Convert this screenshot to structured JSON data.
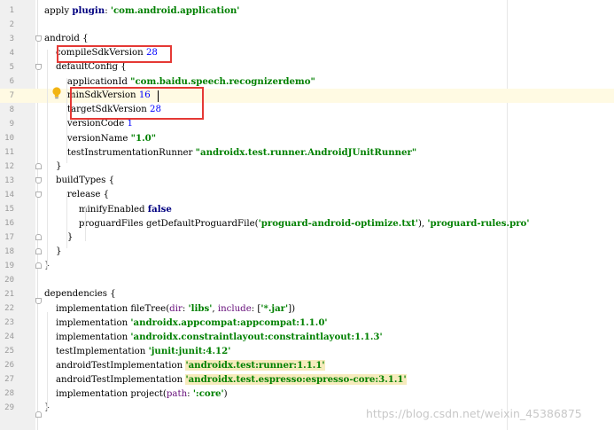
{
  "editor": {
    "lines": [
      {
        "n": "1",
        "segs": [
          [
            "t",
            "apply "
          ],
          [
            "kw",
            "plugin"
          ],
          [
            "t",
            ": "
          ],
          [
            "str",
            "'com.android.application'"
          ]
        ]
      },
      {
        "n": "2",
        "segs": []
      },
      {
        "n": "3",
        "segs": [
          [
            "t",
            "android {"
          ]
        ]
      },
      {
        "n": "4",
        "segs": [
          [
            "t",
            "    compileSdkVersion "
          ],
          [
            "num",
            "28"
          ]
        ]
      },
      {
        "n": "5",
        "segs": [
          [
            "t",
            "    defaultConfig {"
          ]
        ]
      },
      {
        "n": "6",
        "segs": [
          [
            "t",
            "        applicationId "
          ],
          [
            "str",
            "\"com.baidu.speech.recognizerdemo\""
          ]
        ]
      },
      {
        "n": "7",
        "segs": [
          [
            "t",
            "        minSdkVersion "
          ],
          [
            "num",
            "16"
          ]
        ]
      },
      {
        "n": "8",
        "segs": [
          [
            "t",
            "        targetSdkVersion "
          ],
          [
            "num",
            "28"
          ]
        ]
      },
      {
        "n": "9",
        "segs": [
          [
            "t",
            "        versionCode "
          ],
          [
            "num",
            "1"
          ]
        ]
      },
      {
        "n": "10",
        "segs": [
          [
            "t",
            "        versionName "
          ],
          [
            "str",
            "\"1.0\""
          ]
        ]
      },
      {
        "n": "11",
        "segs": [
          [
            "t",
            "        testInstrumentationRunner "
          ],
          [
            "str",
            "\"androidx.test.runner.AndroidJUnitRunner\""
          ]
        ]
      },
      {
        "n": "12",
        "segs": [
          [
            "t",
            "    }"
          ]
        ]
      },
      {
        "n": "13",
        "segs": [
          [
            "t",
            "    buildTypes {"
          ]
        ]
      },
      {
        "n": "14",
        "segs": [
          [
            "t",
            "        release {"
          ]
        ]
      },
      {
        "n": "15",
        "segs": [
          [
            "t",
            "            minifyEnabled "
          ],
          [
            "kw",
            "false"
          ]
        ]
      },
      {
        "n": "16",
        "segs": [
          [
            "t",
            "            proguardFiles getDefaultProguardFile("
          ],
          [
            "str",
            "'proguard-android-optimize.txt'"
          ],
          [
            "t",
            "), "
          ],
          [
            "str",
            "'proguard-rules.pro'"
          ]
        ]
      },
      {
        "n": "17",
        "segs": [
          [
            "t",
            "        }"
          ]
        ]
      },
      {
        "n": "18",
        "segs": [
          [
            "t",
            "    }"
          ]
        ]
      },
      {
        "n": "19",
        "segs": [
          [
            "t",
            "}"
          ]
        ]
      },
      {
        "n": "20",
        "segs": []
      },
      {
        "n": "21",
        "segs": [
          [
            "t",
            "dependencies {"
          ]
        ]
      },
      {
        "n": "22",
        "segs": [
          [
            "t",
            "    implementation fileTree("
          ],
          [
            "param",
            "dir"
          ],
          [
            "t",
            ": "
          ],
          [
            "str",
            "'libs'"
          ],
          [
            "t",
            ", "
          ],
          [
            "param",
            "include"
          ],
          [
            "t",
            ": ["
          ],
          [
            "str",
            "'*.jar'"
          ],
          [
            "t",
            "])"
          ]
        ]
      },
      {
        "n": "23",
        "segs": [
          [
            "t",
            "    implementation "
          ],
          [
            "str",
            "'androidx.appcompat:appcompat:1.1.0'"
          ]
        ]
      },
      {
        "n": "24",
        "segs": [
          [
            "t",
            "    implementation "
          ],
          [
            "str",
            "'androidx.constraintlayout:constraintlayout:1.1.3'"
          ]
        ]
      },
      {
        "n": "25",
        "segs": [
          [
            "t",
            "    testImplementation "
          ],
          [
            "str",
            "'junit:junit:4.12'"
          ]
        ]
      },
      {
        "n": "26",
        "segs": [
          [
            "t",
            "    androidTestImplementation "
          ],
          [
            "hl",
            "'androidx.test:runner:1.1.1'"
          ]
        ]
      },
      {
        "n": "27",
        "segs": [
          [
            "t",
            "    androidTestImplementation "
          ],
          [
            "hl",
            "'androidx.test.espresso:espresso-core:3.1.1'"
          ]
        ]
      },
      {
        "n": "28",
        "segs": [
          [
            "t",
            "    implementation project("
          ],
          [
            "param",
            "path"
          ],
          [
            "t",
            ": "
          ],
          [
            "str",
            "':core'"
          ],
          [
            "t",
            ")"
          ]
        ]
      },
      {
        "n": "29",
        "segs": [
          [
            "t",
            "}"
          ]
        ]
      }
    ],
    "current_line": "7"
  },
  "watermark": "https://blog.csdn.net/weixin_45386875",
  "colors": {
    "keyword": "#000080",
    "string": "#008000",
    "number": "#0000ff",
    "param": "#660e7a",
    "annotation_box": "#e53935"
  },
  "icons": {
    "intention": "lightbulb-icon"
  }
}
